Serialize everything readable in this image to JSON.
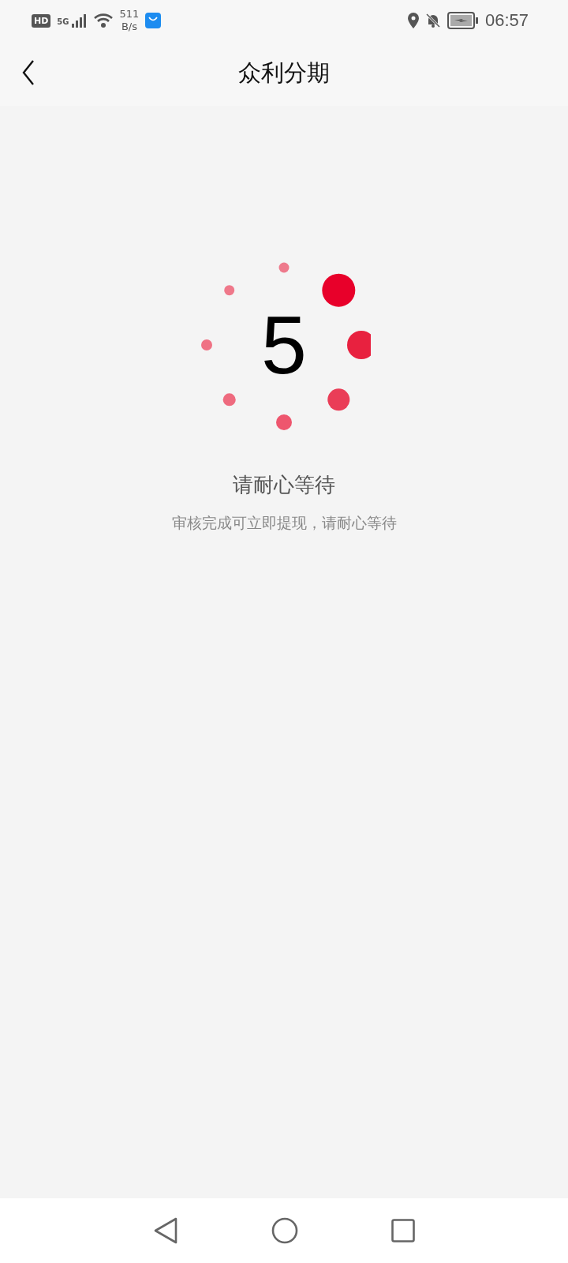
{
  "status_bar": {
    "hd": "HD",
    "network": "5G",
    "speed": "511",
    "speed_unit": "B/s",
    "time": "06:57"
  },
  "header": {
    "title": "众利分期"
  },
  "countdown": "5",
  "message": {
    "title": "请耐心等待",
    "subtitle": "审核完成可立即提现，请耐心等待"
  }
}
